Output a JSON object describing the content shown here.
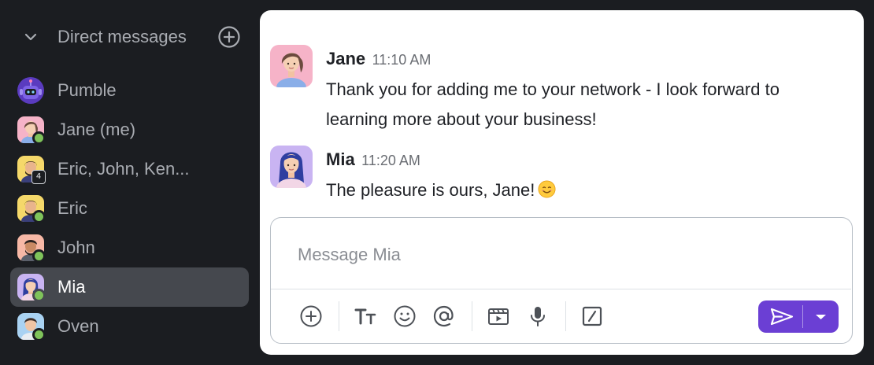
{
  "sidebar": {
    "section_title": "Direct messages",
    "items": [
      {
        "label": "Pumble",
        "avatar": "bot-avatar",
        "status": "none"
      },
      {
        "label": "Jane (me)",
        "avatar": "jane-avatar",
        "status": "online"
      },
      {
        "label": "Eric, John, Ken...",
        "avatar": "group-avatar",
        "status": "count",
        "count": "4"
      },
      {
        "label": "Eric",
        "avatar": "eric-avatar",
        "status": "online"
      },
      {
        "label": "John",
        "avatar": "john-avatar",
        "status": "online"
      },
      {
        "label": "Mia",
        "avatar": "mia-avatar",
        "status": "online",
        "active": true
      },
      {
        "label": "Oven",
        "avatar": "oven-avatar",
        "status": "online"
      }
    ]
  },
  "messages": [
    {
      "author": "Jane",
      "time": "11:10 AM",
      "text": "Thank you for adding me to your network - I look forward to learning more about your business!"
    },
    {
      "author": "Mia",
      "time": "11:20 AM",
      "text": "The pleasure is ours, Jane!",
      "emoji": "smiling-face-emoji"
    }
  ],
  "composer": {
    "placeholder": "Message Mia",
    "tools": [
      "add-icon",
      "text-format-icon",
      "emoji-icon",
      "mention-icon",
      "video-icon",
      "microphone-icon",
      "slash-command-icon",
      "send-icon",
      "chevron-down-icon"
    ]
  },
  "colors": {
    "sidebar_bg": "#1b1d21",
    "active_item_bg": "#45484e",
    "online_status": "#7fc35a",
    "send_button": "#6b3fd4"
  }
}
